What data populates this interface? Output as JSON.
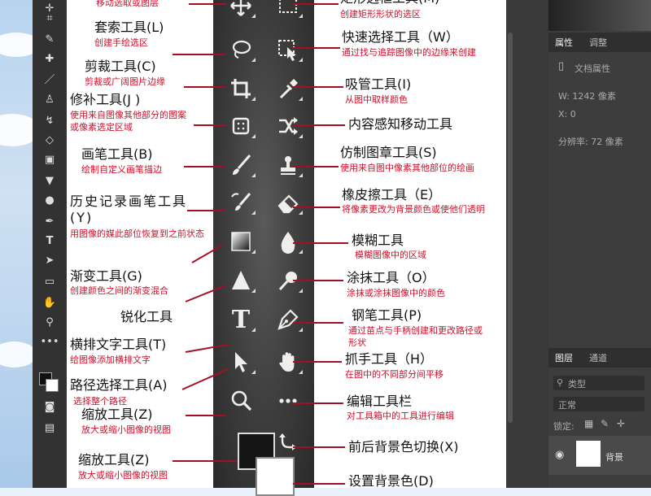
{
  "left_toolbar": {
    "text_tool_glyph": "T"
  },
  "tools_left": [
    {
      "name": "移动选取或图层",
      "desc": ""
    },
    {
      "name": "套索工具(L)",
      "desc": "创建手绘选区"
    },
    {
      "name": "剪裁工具(C)",
      "desc": "剪裁或广阔图片边缘"
    },
    {
      "name": "修补工具(J )",
      "desc": "使用来自图像其他部分的图案 或像素选定区域"
    },
    {
      "name": "画笔工具(B)",
      "desc": "绘制自定义画笔描边"
    },
    {
      "name": "历史记录画笔工具(Y)",
      "desc": "用图像的媒此部位恢复到之前状态"
    },
    {
      "name": "渐变工具(G)",
      "desc": "创建颜色之间的渐变混合"
    },
    {
      "name": "锐化工具",
      "desc": ""
    },
    {
      "name": "横排文字工具(T)",
      "desc": "给图像添加横排文字"
    },
    {
      "name": "路径选择工具(A)",
      "desc": "选择整个路径"
    },
    {
      "name": "缩放工具(Z)",
      "desc": "放大或缩小图像的视图"
    },
    {
      "name": "缩放工具(Z)",
      "desc": "放大或缩小图像的视图"
    }
  ],
  "tools_right": [
    {
      "name": "矩形选框工具(M)",
      "desc": "创建矩形形状的选区"
    },
    {
      "name": "快速选择工具（W）",
      "desc": "通过找与追踪图像中的边缘来创建"
    },
    {
      "name": "吸管工具(I)",
      "desc": "从图中取样颜色"
    },
    {
      "name": "内容感知移动工具",
      "desc": ""
    },
    {
      "name": "仿制图章工具(S)",
      "desc": "使用来自图中像素其他部位的绘画"
    },
    {
      "name": "橡皮擦工具（E）",
      "desc": "将像素更改为背景颜色或使他们透明"
    },
    {
      "name": "模糊工具",
      "desc": "模糊图像中的区域"
    },
    {
      "name": "涂抹工具（O）",
      "desc": "涂抹或涂抹图像中的颜色"
    },
    {
      "name": "钢笔工具(P)",
      "desc": "通过苗点与手柄创建和更改路径或形状"
    },
    {
      "name": "抓手工具（H）",
      "desc": "在图中的不同部分间平移"
    },
    {
      "name": "编辑工具栏",
      "desc": "对工具箱中的工具进行编辑"
    },
    {
      "name": "前后背景色切换(X)",
      "desc": ""
    },
    {
      "name": "设置背景色(D)",
      "desc": ""
    }
  ],
  "center_text_glyph": "T",
  "right_panel": {
    "tab_properties": "属性",
    "tab_adjust": "调整",
    "doc_props": "文档属性",
    "width_label": "W:  1242 像素",
    "x_label": "X: 0",
    "resolution": "分辨率: 72 像素",
    "tab_layers": "图层",
    "tab_channels": "通道",
    "kind": "类型",
    "normal": "正常",
    "lock": "锁定:",
    "layer_name": "背景"
  }
}
